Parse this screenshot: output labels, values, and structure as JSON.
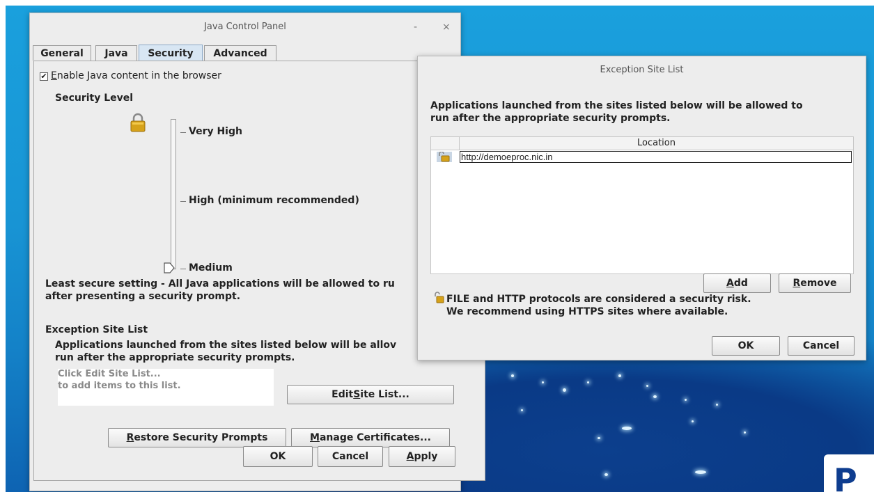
{
  "control_panel": {
    "title": "Java Control Panel",
    "minimize": "-",
    "close": "×",
    "tabs": [
      "General",
      "Java",
      "Security",
      "Advanced"
    ],
    "active_tab": "Security",
    "enable_java_prefix": "E",
    "enable_java_rest": "nable Java content in the browser",
    "enable_java_checked": "✔",
    "security_level_heading": "Security Level",
    "levels": {
      "very_high": "Very High",
      "high": "High (minimum recommended)",
      "medium": "Medium"
    },
    "level_desc_line1": "Least secure setting - All Java applications will be allowed to ru",
    "level_desc_line2": "after presenting a security prompt.",
    "exception_heading": "Exception Site List",
    "exception_desc_line1": "Applications launched from the sites listed below will be allov",
    "exception_desc_line2": "run after the appropriate security prompts.",
    "site_box_line1": "Click Edit Site List...",
    "site_box_line2": "to add items to this list.",
    "edit_site_list": {
      "pre": "Edit ",
      "u": "S",
      "post": "ite List..."
    },
    "restore_prompts": {
      "pre": "",
      "u": "R",
      "post": "estore Security Prompts"
    },
    "manage_certs": {
      "pre": "",
      "u": "M",
      "post": "anage Certificates..."
    },
    "ok": "OK",
    "cancel": "Cancel",
    "apply": {
      "pre": "",
      "u": "A",
      "post": "pply"
    }
  },
  "exception_dialog": {
    "title": "Exception Site List",
    "desc_line1": "Applications launched from the sites listed below will be allowed to",
    "desc_line2": "run after the appropriate security prompts.",
    "column_location": "Location",
    "rows": [
      {
        "location": "http://demoeproc.nic.in"
      }
    ],
    "add": {
      "pre": "",
      "u": "A",
      "post": "dd"
    },
    "remove": {
      "pre": "",
      "u": "R",
      "post": "emove"
    },
    "warning_line1": "FILE and HTTP protocols are considered a security risk.",
    "warning_line2": "We recommend using HTTPS sites where available.",
    "ok": "OK",
    "cancel": "Cancel"
  },
  "desktop": {
    "logo_text": "P"
  },
  "colors": {
    "accent_tab": "#d8e6f3",
    "lock_gold": "#d6a21a",
    "wallpaper_blue": "#1894d4"
  }
}
